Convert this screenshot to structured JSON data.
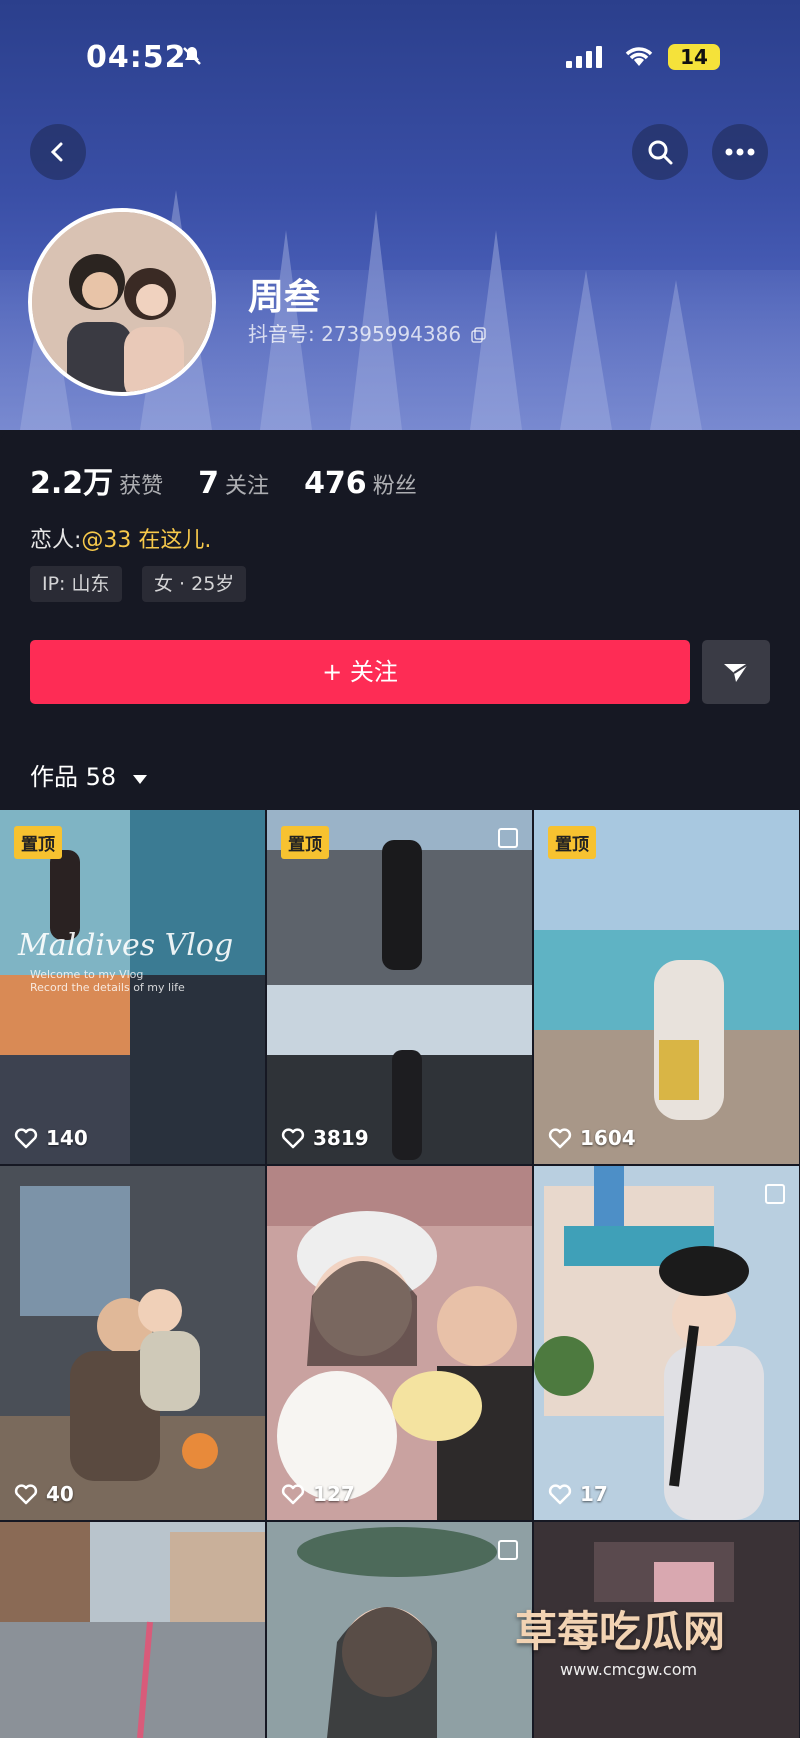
{
  "status_bar": {
    "time": "04:52",
    "battery": "14"
  },
  "profile": {
    "name": "周叁",
    "douyin_id": "抖音号: 27395994386",
    "stats": [
      {
        "value": "2.2万",
        "label": "获赞"
      },
      {
        "value": "7",
        "label": "关注"
      },
      {
        "value": "476",
        "label": "粉丝"
      }
    ],
    "lover_label": "恋人:",
    "lover_mention": "@33 在这儿.",
    "tags": [
      "IP: 山东",
      "女 · 25岁"
    ],
    "follow_label": "+ 关注"
  },
  "works": {
    "label": "作品 58"
  },
  "grid": [
    {
      "pinned": true,
      "pin_label": "置顶",
      "likes": "140",
      "overlay_text": "Maldives Vlog",
      "overlay_sub": "Welcome to my Vlog\nRecord the details of my life",
      "multi": false
    },
    {
      "pinned": true,
      "pin_label": "置顶",
      "likes": "3819",
      "multi": true
    },
    {
      "pinned": true,
      "pin_label": "置顶",
      "likes": "1604",
      "multi": false
    },
    {
      "pinned": false,
      "likes": "40",
      "multi": false
    },
    {
      "pinned": false,
      "likes": "127",
      "multi": false
    },
    {
      "pinned": false,
      "likes": "17",
      "multi": true
    },
    {
      "pinned": false,
      "likes": "",
      "multi": false
    },
    {
      "pinned": false,
      "likes": "",
      "multi": true
    },
    {
      "pinned": false,
      "likes": "",
      "multi": false
    }
  ],
  "watermark": {
    "title": "草莓吃瓜网",
    "url": "www.cmcgw.com"
  },
  "icons": {
    "back": "back-chevron-icon",
    "search": "search-icon",
    "more": "more-dots-icon",
    "share": "share-arrow-icon",
    "heart": "heart-outline-icon",
    "copy": "copy-icon"
  },
  "colors": {
    "accent": "#fe2c55",
    "mention": "#f7c94b",
    "pin": "#f7c230",
    "bg": "#161823"
  }
}
